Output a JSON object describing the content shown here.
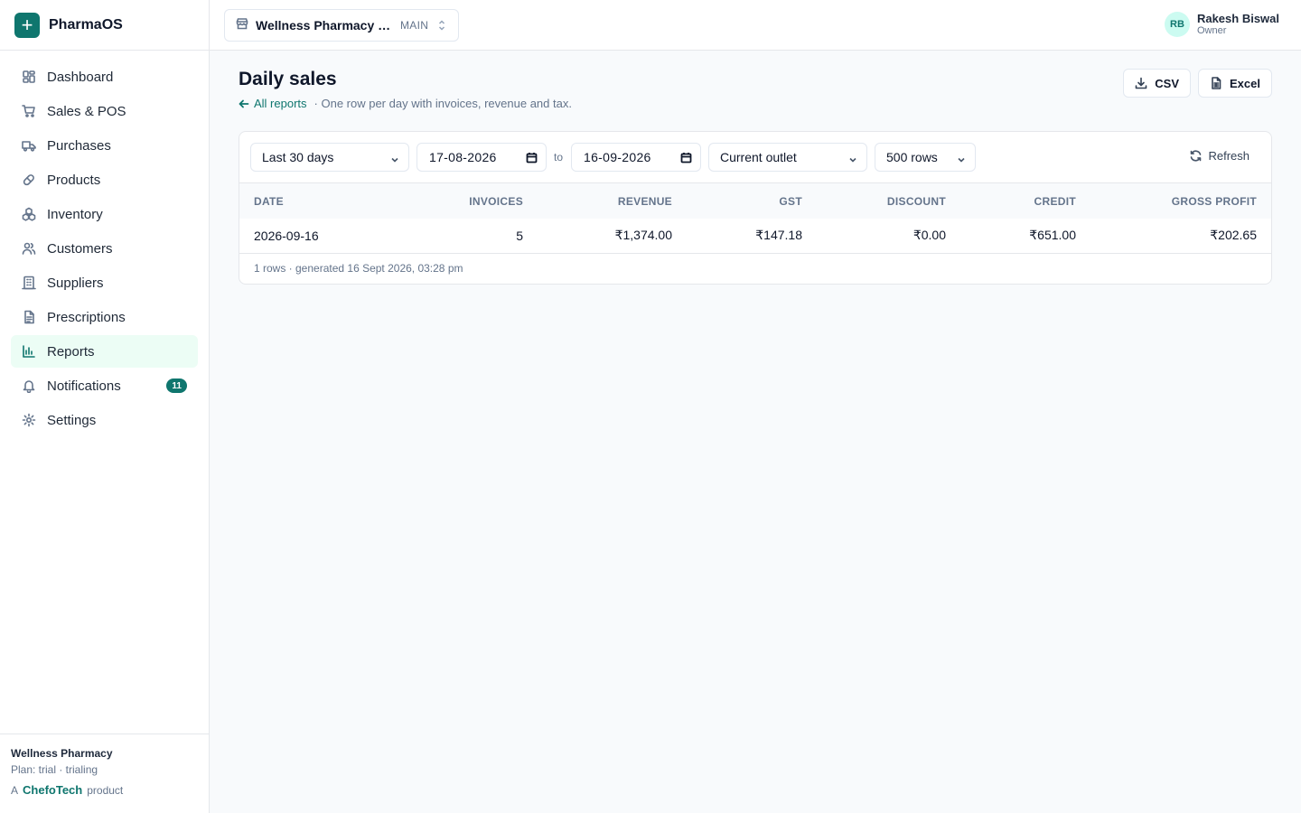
{
  "app": {
    "name": "PharmaOS",
    "logo_glyph": "+"
  },
  "sidebar": {
    "items": [
      {
        "label": "Dashboard",
        "icon": "dashboard-icon"
      },
      {
        "label": "Sales & POS",
        "icon": "cart-icon"
      },
      {
        "label": "Purchases",
        "icon": "truck-icon"
      },
      {
        "label": "Products",
        "icon": "pill-icon"
      },
      {
        "label": "Inventory",
        "icon": "boxes-icon"
      },
      {
        "label": "Customers",
        "icon": "users-icon"
      },
      {
        "label": "Suppliers",
        "icon": "building-icon"
      },
      {
        "label": "Prescriptions",
        "icon": "document-icon"
      },
      {
        "label": "Reports",
        "icon": "bar-chart-icon",
        "active": true
      },
      {
        "label": "Notifications",
        "icon": "bell-icon",
        "badge": "11"
      },
      {
        "label": "Settings",
        "icon": "gear-icon"
      }
    ],
    "footer": {
      "org": "Wellness Pharmacy",
      "plan": "Plan: trial · trialing",
      "credit_prefix": "A",
      "credit_brand": "ChefoTech",
      "credit_suffix": "product"
    }
  },
  "topbar": {
    "outlet_name": "Wellness Pharmacy · Main",
    "outlet_tag": "MAIN",
    "user": {
      "initials": "RB",
      "name": "Rakesh Biswal",
      "role": "Owner"
    }
  },
  "page": {
    "title": "Daily sales",
    "back_label": "All reports",
    "description": "· One row per day with invoices, revenue and tax.",
    "export": {
      "csv_label": "CSV",
      "excel_label": "Excel"
    }
  },
  "filters": {
    "range": "Last 30 days",
    "from_date": "17-08-2026",
    "to_label": "to",
    "to_date": "16-09-2026",
    "outlet": "Current outlet",
    "rows": "500 rows",
    "refresh_label": "Refresh"
  },
  "table": {
    "columns": [
      "DATE",
      "INVOICES",
      "REVENUE",
      "GST",
      "DISCOUNT",
      "CREDIT",
      "GROSS PROFIT"
    ],
    "rows": [
      [
        "2026-09-16",
        "5",
        "₹1,374.00",
        "₹147.18",
        "₹0.00",
        "₹651.00",
        "₹202.65"
      ]
    ],
    "footnote": "1 rows · generated 16 Sept 2026, 03:28 pm"
  },
  "colors": {
    "accent": "#0f766e",
    "active_bg": "#ecfdf5",
    "avatar_bg": "#ccfbf1"
  }
}
